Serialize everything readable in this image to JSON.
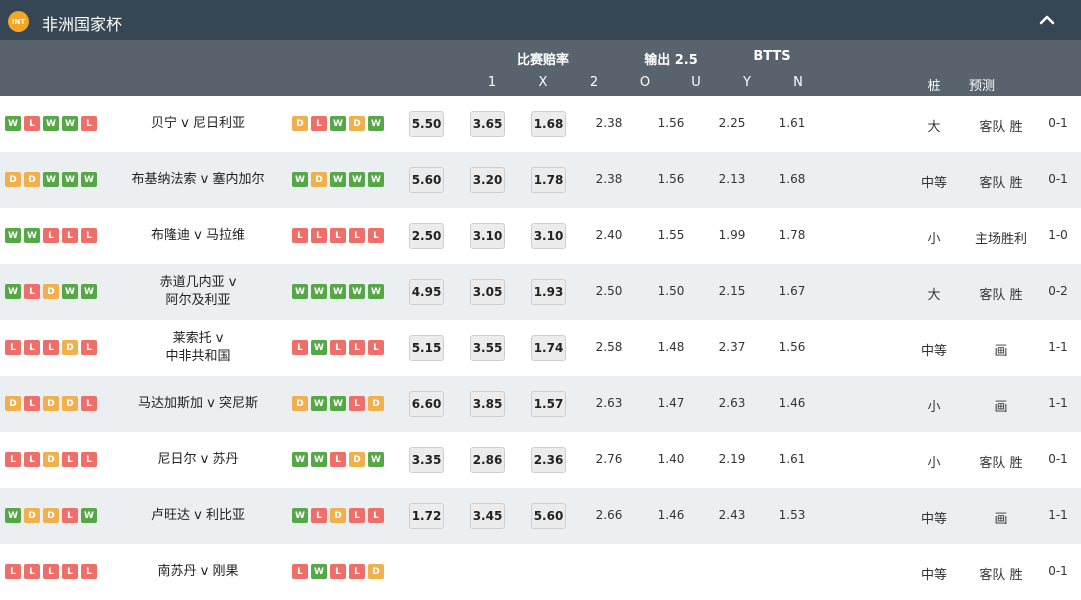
{
  "header": {
    "badge": "INT",
    "title": "非洲国家杯",
    "collapse_icon": "chevron-up-icon"
  },
  "subheader": {
    "group_odds": "比赛赔率",
    "group_ou": "输出 2.5",
    "group_btts": "BTTS",
    "col_1": "1",
    "col_x": "X",
    "col_2": "2",
    "col_o": "O",
    "col_u": "U",
    "col_y": "Y",
    "col_n": "N",
    "col_zhuang": "桩",
    "col_pred": "预测"
  },
  "colors": {
    "header_bg": "#374654",
    "subheader_bg": "#59636d",
    "win": "#55a845",
    "loss": "#ee6e6a",
    "draw": "#f1b04e",
    "badge": "#f5a623"
  },
  "rows": [
    {
      "home_form": [
        "W",
        "L",
        "W",
        "W",
        "L"
      ],
      "match": "贝宁 v 尼日利亚",
      "away_form": [
        "D",
        "L",
        "W",
        "D",
        "W"
      ],
      "odd1": "5.50",
      "oddx": "3.65",
      "odd2": "1.68",
      "v2": "2.38",
      "o": "1.56",
      "y": "2.25",
      "n": "1.61",
      "zhuang": "大",
      "pred": "客队 胜",
      "score": "0-1"
    },
    {
      "home_form": [
        "D",
        "D",
        "W",
        "W",
        "W"
      ],
      "match": "布基纳法索 v 塞内加尔",
      "away_form": [
        "W",
        "D",
        "W",
        "W",
        "W"
      ],
      "odd1": "5.60",
      "oddx": "3.20",
      "odd2": "1.78",
      "v2": "2.38",
      "o": "1.56",
      "y": "2.13",
      "n": "1.68",
      "zhuang": "中等",
      "pred": "客队 胜",
      "score": "0-1"
    },
    {
      "home_form": [
        "W",
        "W",
        "L",
        "L",
        "L"
      ],
      "match": "布隆迪 v 马拉维",
      "away_form": [
        "L",
        "L",
        "L",
        "L",
        "L"
      ],
      "odd1": "2.50",
      "oddx": "3.10",
      "odd2": "3.10",
      "v2": "2.40",
      "o": "1.55",
      "y": "1.99",
      "n": "1.78",
      "zhuang": "小",
      "pred": "主场胜利",
      "score": "1-0"
    },
    {
      "home_form": [
        "W",
        "L",
        "D",
        "W",
        "W"
      ],
      "match": "赤道几内亚 v\n阿尔及利亚",
      "away_form": [
        "W",
        "W",
        "W",
        "W",
        "W"
      ],
      "odd1": "4.95",
      "oddx": "3.05",
      "odd2": "1.93",
      "v2": "2.50",
      "o": "1.50",
      "y": "2.15",
      "n": "1.67",
      "zhuang": "大",
      "pred": "客队 胜",
      "score": "0-2"
    },
    {
      "home_form": [
        "L",
        "L",
        "L",
        "D",
        "L"
      ],
      "match": "莱索托 v\n中非共和国",
      "away_form": [
        "L",
        "W",
        "L",
        "L",
        "L"
      ],
      "odd1": "5.15",
      "oddx": "3.55",
      "odd2": "1.74",
      "v2": "2.58",
      "o": "1.48",
      "y": "2.37",
      "n": "1.56",
      "zhuang": "中等",
      "pred": "画",
      "score": "1-1"
    },
    {
      "home_form": [
        "D",
        "L",
        "D",
        "D",
        "L"
      ],
      "match": "马达加斯加 v 突尼斯",
      "away_form": [
        "D",
        "W",
        "W",
        "L",
        "D"
      ],
      "odd1": "6.60",
      "oddx": "3.85",
      "odd2": "1.57",
      "v2": "2.63",
      "o": "1.47",
      "y": "2.63",
      "n": "1.46",
      "zhuang": "小",
      "pred": "画",
      "score": "1-1"
    },
    {
      "home_form": [
        "L",
        "L",
        "D",
        "L",
        "L"
      ],
      "match": "尼日尔 v 苏丹",
      "away_form": [
        "W",
        "W",
        "L",
        "D",
        "W"
      ],
      "odd1": "3.35",
      "oddx": "2.86",
      "odd2": "2.36",
      "v2": "2.76",
      "o": "1.40",
      "y": "2.19",
      "n": "1.61",
      "zhuang": "小",
      "pred": "客队 胜",
      "score": "0-1"
    },
    {
      "home_form": [
        "W",
        "D",
        "D",
        "L",
        "W"
      ],
      "match": "卢旺达 v 利比亚",
      "away_form": [
        "W",
        "L",
        "D",
        "L",
        "L"
      ],
      "odd1": "1.72",
      "oddx": "3.45",
      "odd2": "5.60",
      "v2": "2.66",
      "o": "1.46",
      "y": "2.43",
      "n": "1.53",
      "zhuang": "中等",
      "pred": "画",
      "score": "1-1"
    },
    {
      "home_form": [
        "L",
        "L",
        "L",
        "L",
        "L"
      ],
      "match": "南苏丹 v 刚果",
      "away_form": [
        "L",
        "W",
        "L",
        "L",
        "D"
      ],
      "odd1": "",
      "oddx": "",
      "odd2": "",
      "v2": "",
      "o": "",
      "y": "",
      "n": "",
      "zhuang": "中等",
      "pred": "客队 胜",
      "score": "0-1"
    }
  ]
}
